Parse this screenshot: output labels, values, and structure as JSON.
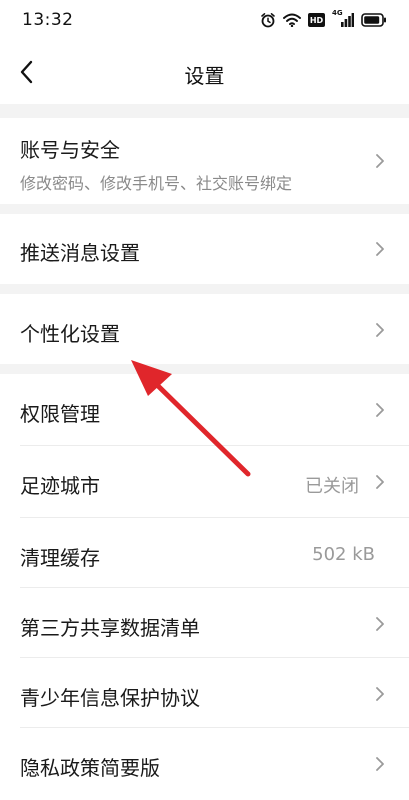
{
  "status_bar": {
    "time": "13:32",
    "icons": [
      "alarm-icon",
      "wifi-icon",
      "hd-badge",
      "signal-4g-icon",
      "battery-icon"
    ],
    "hd_label": "HD",
    "network_label": "4G"
  },
  "header": {
    "title": "设置",
    "back_icon": "back-arrow-icon"
  },
  "settings": {
    "account": {
      "label": "账号与安全",
      "subtitle": "修改密码、修改手机号、社交账号绑定"
    },
    "push": {
      "label": "推送消息设置"
    },
    "personalize": {
      "label": "个性化设置"
    },
    "permissions": {
      "label": "权限管理"
    },
    "footprint": {
      "label": "足迹城市",
      "value": "已关闭"
    },
    "cache": {
      "label": "清理缓存",
      "value": "502 kB"
    },
    "third_party": {
      "label": "第三方共享数据清单"
    },
    "youth": {
      "label": "青少年信息保护协议"
    },
    "privacy": {
      "label": "隐私政策简要版"
    }
  },
  "colors": {
    "annotation_arrow": "#e0262b",
    "background": "#f3f3f3",
    "secondary_text": "#8a8a8a"
  }
}
